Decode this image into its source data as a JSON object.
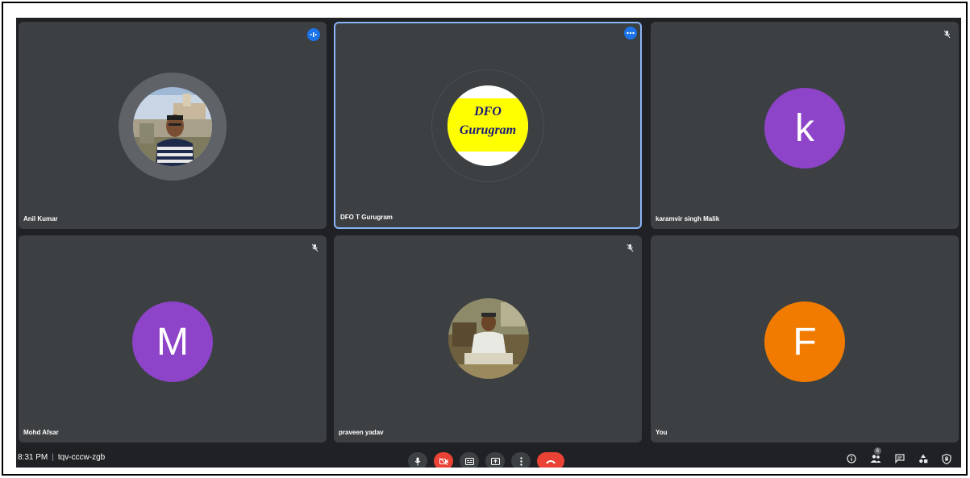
{
  "participants": [
    {
      "name": "Anil Kumar",
      "corner_icon": "audio-waveform-icon"
    },
    {
      "name": "DFO T Gurugram",
      "corner_icon": "more-options-icon",
      "logo_line1": "DFO",
      "logo_line2": "Gurugram"
    },
    {
      "name": "karamvir singh Malik",
      "corner_icon": "mic-off-icon",
      "initial": "k",
      "color": "#8e44c9"
    },
    {
      "name": "Mohd Afsar",
      "corner_icon": "mic-off-icon",
      "initial": "M",
      "color": "#8e44c9"
    },
    {
      "name": "praveen yadav",
      "corner_icon": "mic-off-icon"
    },
    {
      "name": "You",
      "initial": "F",
      "color": "#f07b00"
    }
  ],
  "meeting": {
    "time": "8:31 PM",
    "separator": "|",
    "code": "tqv-cccw-zgb"
  },
  "people_count": "6",
  "colors": {
    "tile_bg": "#3c4043",
    "page_bg": "#202124",
    "active_border": "#8ab4f8",
    "hangup_red": "#ea4335"
  }
}
